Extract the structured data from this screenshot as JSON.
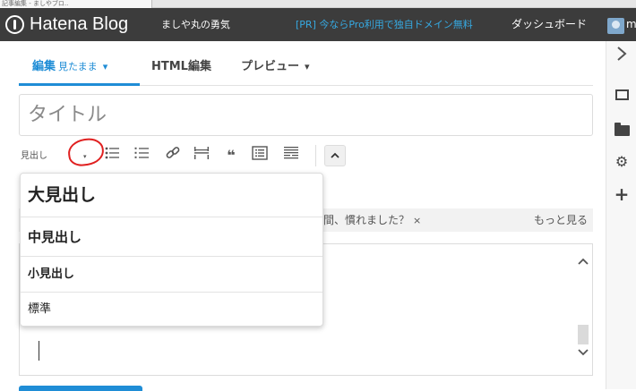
{
  "browser": {
    "tab_title": "記事編集 - ましやブロ.."
  },
  "topbar": {
    "brand": "Hatena Blog",
    "blog_name": "ましや丸の勇気",
    "promo": "[PR] 今ならPro利用で独自ドメイン無料",
    "dashboard": "ダッシュボード",
    "user_initial": "m"
  },
  "tabs": {
    "edit_label": "編集",
    "edit_mode": "見たまま",
    "html_label": "HTML編集",
    "preview_label": "プレビュー",
    "caret": "▾"
  },
  "title_field": {
    "placeholder": "タイトル",
    "value": ""
  },
  "toolbar": {
    "heading_value": "見出し",
    "heading_arrow": "▾",
    "icons": [
      "bullet-list-icon",
      "numbered-list-icon",
      "link-icon",
      "read-more-icon",
      "quote-icon",
      "table-of-contents-icon",
      "horizontal-rule-icon",
      "collapse-toolbar-icon"
    ],
    "collapse": "^"
  },
  "heading_dropdown": {
    "options": [
      {
        "label": "大見出し"
      },
      {
        "label": "中見出し"
      },
      {
        "label": "小見出し"
      },
      {
        "label": "標準"
      }
    ]
  },
  "notice": {
    "text": "間、慣れました？",
    "close": "×",
    "more": "もっと見る"
  },
  "editor": {
    "content": ""
  },
  "sidebar": {
    "icons": [
      "collapse-panel-icon",
      "image-icon",
      "folder-icon",
      "settings-icon",
      "add-icon"
    ]
  },
  "colors": {
    "topbar_bg": "#3c3c3c",
    "accent": "#1f8dd6",
    "promo": "#36a9e1",
    "annotation": "#e02020"
  }
}
